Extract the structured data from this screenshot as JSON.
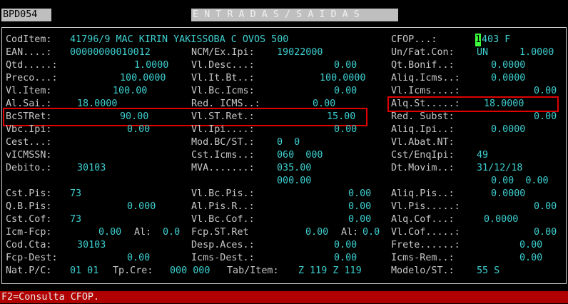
{
  "header": {
    "screen_id": "BPD054",
    "title": "E N T R A D A S / S A I D A S"
  },
  "fields": {
    "coditem_label": "CodItem:",
    "coditem_value": "41796/9 MAC KIRIN YAKISSOBA C OVOS 500",
    "cfop_label": "CFOP...:",
    "cfop_cursor": "1",
    "cfop_value": "403 F",
    "ean_label": "EAN....:",
    "ean_value": "00000000010012",
    "ncm_label": "NCM/Ex.Ipi:",
    "ncm_value": "19022000",
    "unfat_label": "Un/Fat.Con:",
    "unfat_un": "UN",
    "unfat_value": "1.0000",
    "qtd_label": "Qtd.....:",
    "qtd_value": "1.0000",
    "vldesc_label": "Vl.Desc...:",
    "vldesc_value": "0.00",
    "qtbonif_label": "Qt.Bonif..:",
    "qtbonif_value": "0.0000",
    "preco_label": "Preco...:",
    "preco_value": "100.0000",
    "vlitbt_label": "Vl.It.Bt..:",
    "vlitbt_value": "100.0000",
    "aliqicms_label": "Aliq.Icms..:",
    "aliqicms_value": "0.0000",
    "vlitem_label": "Vl.Item:",
    "vlitem_value": "100.00",
    "vlbcicms_label": "Vl.Bc.Icms:",
    "vlbcicms_value": "0.00",
    "vlicms_label": "Vl.Icms....:",
    "vlicms_value": "0.00",
    "alsai_label": "Al.Sai.:",
    "alsai_value": "18.0000",
    "redicms_label": "Red. ICMS..:",
    "redicms_value": "0.00",
    "alqst_label": "Alq.St.....:",
    "alqst_value": "18.0000",
    "bcstret_label": "BcSTRet:",
    "bcstret_value": "90.00",
    "vlstret_label": "Vl.ST.Ret.:",
    "vlstret_value": "15.00",
    "redsubst_label": "Red. Subst:",
    "redsubst_value": "0.00",
    "vbcipi_label": "Vbc.Ipi:",
    "vbcipi_value": "0.00",
    "vlipi_label": "Vl.Ipi....:",
    "vlipi_value": "0.00",
    "aliqipi_label": "Aliq.Ipi..:",
    "aliqipi_value": "0.0000",
    "cest_label": "Cest...:",
    "modbcst_label": "Mod.BC/ST.:",
    "modbcst_value": "0  0",
    "vlabatnt_label": "Vl.Abat.NT:",
    "vicmssn_label": "vICMSSN:",
    "csticms_label": "Cst.Icms..:",
    "csticms_value": "060  000",
    "cstenqipi_label": "Cst/EnqIpi:",
    "cstenqipi_value": "49",
    "debito_label": "Debito.:",
    "debito_value": "30103",
    "mva_label": "MVA.......:",
    "mva_value": "035.00",
    "dtmovim_label": "Dt.Movim..:",
    "dtmovim_value": "31/12/18",
    "mva_value2": "000.00",
    "dtmovim_extra": "0.00  0.00",
    "cstpis_label": "Cst.Pis:",
    "cstpis_value": "73",
    "vlbcpis_label": "Vl.Bc.Pis.:",
    "vlbcpis_value": "0.00",
    "aliqpis_label": "Aliq.Pis..:",
    "aliqpis_value": "0.0000",
    "qbpis_label": "Q.B.Pis:",
    "qbpis_value": "0.000",
    "alpisr_label": "Al.Pis.R..:",
    "alpisr_value": "0.00",
    "vlpis_label": "Vl.Pis.....:",
    "vlpis_value": "0.00",
    "cstcof_label": "Cst.Cof:",
    "cstcof_value": "73",
    "vlbccof_label": "Vl.Bc.Cof.:",
    "vlbccof_value": "0.00",
    "aliqcof_label": "Alq.Cof...:",
    "aliqcof_value": "0.0000",
    "icmfcp_label": "Icm-Fcp:",
    "icmfcp_value": "0.00",
    "al_label": "Al:",
    "al_value": "0.0",
    "fcpstret_label": "Fcp.ST.Ret",
    "fcpstret_value": "0.00",
    "al2_label": "Al:",
    "al2_value": "0.0",
    "vlcof_label": "Vl.Cof.....:",
    "vlcof_value": "0.00",
    "codcta_label": "Cod.Cta:",
    "codcta_value": "30103",
    "despaces_label": "Desp.Aces.:",
    "despaces_value": "0.00",
    "frete_label": "Frete......:",
    "frete_value": "0.00",
    "fcpdest_label": "Fcp-Dest:",
    "fcpdest_value": "0.00",
    "icmsdest_label": "Icms-Dest.:",
    "icmsdest_value": "0.00",
    "icmsrem_label": "Icms-Rem..:",
    "icmsrem_value": "0.00",
    "natpc_label": "Nat.P/C:",
    "natpc_value": "01 01",
    "tpcre_label": "Tp.Cre:",
    "tpcre_value": "000 000",
    "tabitem_label": "Tab/Item:",
    "tabitem_value": "Z 119 Z 119",
    "modelost_label": "Modelo/ST.:",
    "modelost_value": "55 S"
  },
  "status_bar": {
    "text": "F2=Consulta CFOP."
  },
  "colors": {
    "background": "#000000",
    "label": "#c8c8c8",
    "value": "#3ecfcf",
    "highlight_box": "#e00000",
    "status_bar": "#b00000",
    "cursor": "#3cff3c"
  }
}
